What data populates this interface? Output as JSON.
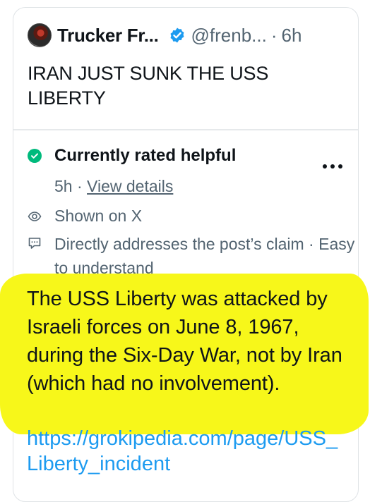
{
  "post": {
    "author_name": "Trucker Fr...",
    "handle": "@frenb...",
    "separator": "·",
    "time": "6h",
    "text": "IRAN JUST SUNK THE USS LIBERTY"
  },
  "community_note": {
    "status": "Currently rated helpful",
    "age": "5h",
    "meta_separator": "·",
    "view_details": "View details",
    "shown_on": "Shown on X",
    "reasons": "Directly addresses the post’s claim · Easy to understand",
    "note_text": "The USS Liberty was attacked by Israeli forces on June 8, 1967, during the Six-Day War, not by Iran (which had no involvement).",
    "link": "https://grokipedia.com/page/USS_Liberty_incident"
  },
  "colors": {
    "accent_blue": "#1d9bf0",
    "verified_blue": "#1d9bf0",
    "helpful_green": "#00ba7c",
    "highlight_yellow": "#f7f71a",
    "secondary_text": "#536471"
  },
  "icons": {
    "avatar": "avatar",
    "verified": "verified-badge-icon",
    "helpful": "check-circle-icon",
    "more": "more-dots-icon",
    "shown": "eye-icon",
    "reasons": "speech-bubble-icon"
  }
}
